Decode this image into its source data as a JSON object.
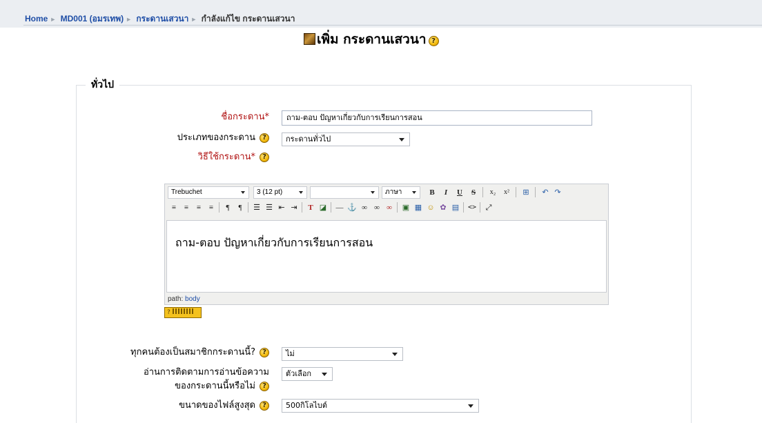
{
  "breadcrumb": {
    "home": "Home",
    "course": "MD001 (อมรเทพ)",
    "forums": "กระดานเสวนา",
    "current": "กำลังแก้ไข กระดานเสวนา",
    "separator": "►"
  },
  "page": {
    "title": "เพิ่ม กระดานเสวนา",
    "help_glyph": "?"
  },
  "form": {
    "section": "ทั่วไป",
    "name_label": "ชื่อกระดาน",
    "required_mark": "*",
    "name_value": "ถาม-ตอบ ปัญหาเกี่ยวกับการเรียนการสอน",
    "type_label": "ประเภทของกระดาน",
    "type_value": "กระดานทั่วไป",
    "intro_label": "วิธีใช้กระดาน",
    "force_sub_label": "ทุกคนต้องเป็นสมาชิกกระดานนี้?",
    "force_sub_value": "ไม่",
    "track_label_line1": "อ่านการติดตามการอ่านข้อความ",
    "track_label_line2": "ของกระดานนี้หรือไม่",
    "track_value": "ตัวเลือก",
    "maxsize_label": "ขนาดของไฟล์สูงสุด",
    "maxsize_value": "500กิโลไบต์"
  },
  "editor": {
    "font_family": "Trebuchet",
    "font_size": "3 (12 pt)",
    "heading": "",
    "language": "ภาษา",
    "content": "ถาม-ตอบ ปัญหาเกี่ยวกับการเรียนการสอน",
    "path_label": "path:",
    "path_value": "body",
    "buttons_row1": [
      "B",
      "I",
      "U",
      "S",
      "x₂",
      "x²",
      "⊞",
      "↶",
      "↷"
    ],
    "buttons_row2": [
      "≡",
      "≡",
      "≡",
      "≡",
      "¶",
      "¶",
      "☰",
      "☰",
      "⇤",
      "⇥",
      "T",
      "◪",
      "—",
      "⚓",
      "∞",
      "∞",
      "∞",
      "▣",
      "▦",
      "☺",
      "✿",
      "▤",
      "<>",
      "⤢"
    ]
  }
}
